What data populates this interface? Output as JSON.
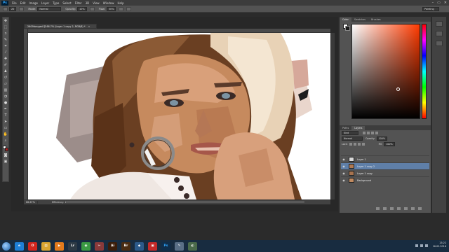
{
  "app": {
    "logo": "Ps",
    "menu": [
      "File",
      "Edit",
      "Image",
      "Layer",
      "Type",
      "Select",
      "Filter",
      "3D",
      "View",
      "Window",
      "Help"
    ],
    "window_controls": [
      "–",
      "▭",
      "✕"
    ]
  },
  "options_bar": {
    "brush_size": "20",
    "mode_label": "Mode:",
    "mode_value": "Normal",
    "opacity_label": "Opacity:",
    "opacity_value": "10%",
    "flow_label": "Flow:",
    "flow_value": "50%",
    "workspace": "Painting"
  },
  "document": {
    "tab_title": "2609faruged @ 66.7% (Layer 1 copy 2, RGB/8) *",
    "zoom": "66.67%",
    "efficiency": "Efficiency: 100%*"
  },
  "color_panel": {
    "tabs": [
      "Color",
      "Swatches",
      "Brushes"
    ],
    "fg_color": "#ffffff",
    "bg_color": "#1a1a1a",
    "hue_color": "#ff3a00"
  },
  "layers_panel": {
    "tabs": [
      "Paths",
      "Layers"
    ],
    "kind_filter": "Kind",
    "blend_mode": "Normal",
    "opacity_label": "Opacity:",
    "opacity_value": "100%",
    "lock_label": "Lock:",
    "fill_label": "Fill:",
    "fill_value": "100%",
    "layers": [
      {
        "name": "Layer 1",
        "selected": false,
        "thumb": "#d9d9d9"
      },
      {
        "name": "Layer 1 copy 2",
        "selected": true,
        "thumb": "#b07a52"
      },
      {
        "name": "Layer 1 copy",
        "selected": false,
        "thumb": "#a8734e"
      },
      {
        "name": "Background",
        "selected": false,
        "thumb": "#c08a60"
      }
    ]
  },
  "taskbar": {
    "apps": [
      {
        "name": "ie",
        "label": "e",
        "color": "#1e7fd6"
      },
      {
        "name": "opera",
        "label": "O",
        "color": "#d0261f"
      },
      {
        "name": "explorer",
        "label": "▤",
        "color": "#d9a531"
      },
      {
        "name": "media",
        "label": "▶",
        "color": "#e07a1c"
      },
      {
        "name": "lightroom",
        "label": "Lr",
        "color": "#2d3a44"
      },
      {
        "name": "chrome",
        "label": "◉",
        "color": "#3a9b43"
      },
      {
        "name": "tool",
        "label": "✂",
        "color": "#8a3a3a"
      },
      {
        "name": "illustrator",
        "label": "Ai",
        "color": "#3b1d0a"
      },
      {
        "name": "bridge",
        "label": "Br",
        "color": "#4a2c12"
      },
      {
        "name": "other",
        "label": "◆",
        "color": "#2c5a8a"
      },
      {
        "name": "photoshop-red",
        "label": "▣",
        "color": "#c42a2a"
      },
      {
        "name": "photoshop",
        "label": "Ps",
        "color": "#0f2d4a"
      },
      {
        "name": "notes",
        "label": "✎",
        "color": "#5a6f86"
      },
      {
        "name": "misc",
        "label": "◐",
        "color": "#4a6a4a"
      }
    ],
    "time": "13:22",
    "date": "16.02.2016"
  }
}
